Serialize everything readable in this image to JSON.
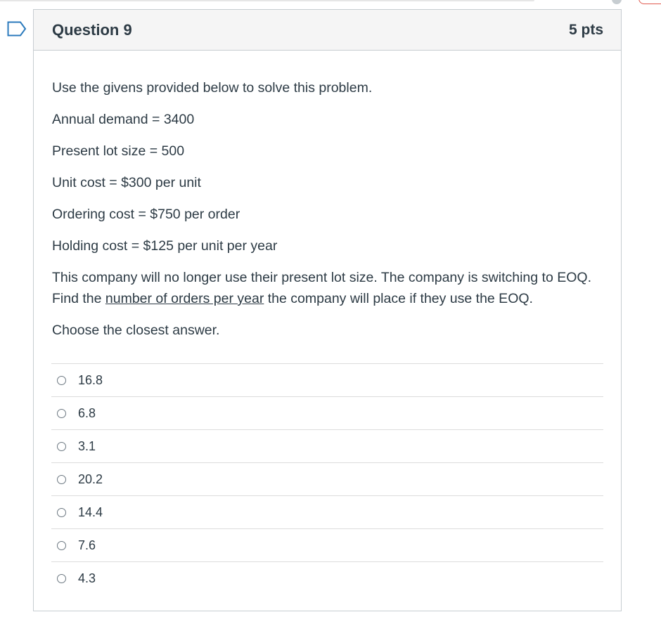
{
  "question": {
    "title": "Question 9",
    "points": "5 pts",
    "paragraphs": {
      "intro": "Use the givens provided below to solve this problem.",
      "annual_demand": "Annual demand = 3400",
      "lot_size": "Present lot size = 500",
      "unit_cost": "Unit cost = $300 per unit",
      "ordering_cost": "Ordering cost = $750 per order",
      "holding_cost": "Holding cost = $125 per unit per year",
      "prompt_part1": "This company will no longer use their present lot size.  The company is switching to EOQ.  Find the ",
      "prompt_underlined": "number of orders per year",
      "prompt_part2": " the company will place if they use the EOQ.",
      "closing": "Choose the closest answer."
    },
    "answers": [
      "16.8",
      "6.8",
      "3.1",
      "20.2",
      "14.4",
      "7.6",
      "4.3"
    ],
    "selected_answer": null
  },
  "icons": {
    "flag": "flag-outline-icon",
    "radio": "radio-unchecked-icon"
  },
  "colors": {
    "text": "#2d3b45",
    "header_bg": "#f5f5f5",
    "border": "#c7cdd1",
    "flag": "#2b7abc"
  }
}
